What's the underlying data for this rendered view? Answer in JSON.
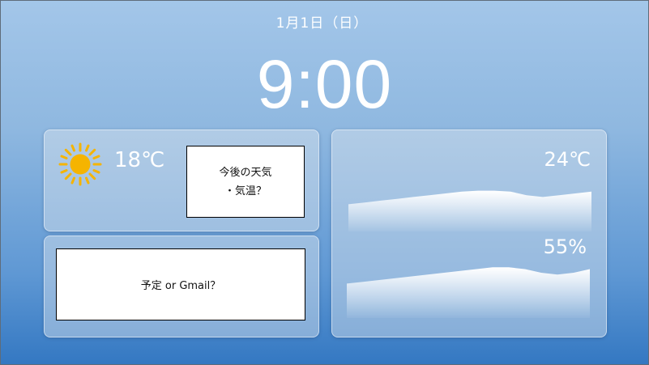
{
  "header": {
    "date": "1月1日（日）",
    "time": "9:00"
  },
  "weather": {
    "icon": "sun-icon",
    "current_temp": "18℃",
    "forecast_placeholder_line1": "今後の天気",
    "forecast_placeholder_line2": "・気温？"
  },
  "schedule": {
    "placeholder": "予定 or Gmail？"
  },
  "sensors": {
    "temperature": {
      "label": "24℃",
      "trend": [
        0.3,
        0.32,
        0.34,
        0.36,
        0.38,
        0.4,
        0.42,
        0.44,
        0.45,
        0.45,
        0.44,
        0.4,
        0.38,
        0.4,
        0.42,
        0.44
      ]
    },
    "humidity": {
      "label": "55%",
      "trend": [
        0.38,
        0.4,
        0.42,
        0.44,
        0.46,
        0.48,
        0.5,
        0.52,
        0.54,
        0.56,
        0.56,
        0.54,
        0.5,
        0.48,
        0.5,
        0.54
      ]
    }
  },
  "colors": {
    "background_top": "#a3c6e9",
    "background_bottom": "#3478c2",
    "text": "#ffffff",
    "sun": "#f5b400"
  }
}
